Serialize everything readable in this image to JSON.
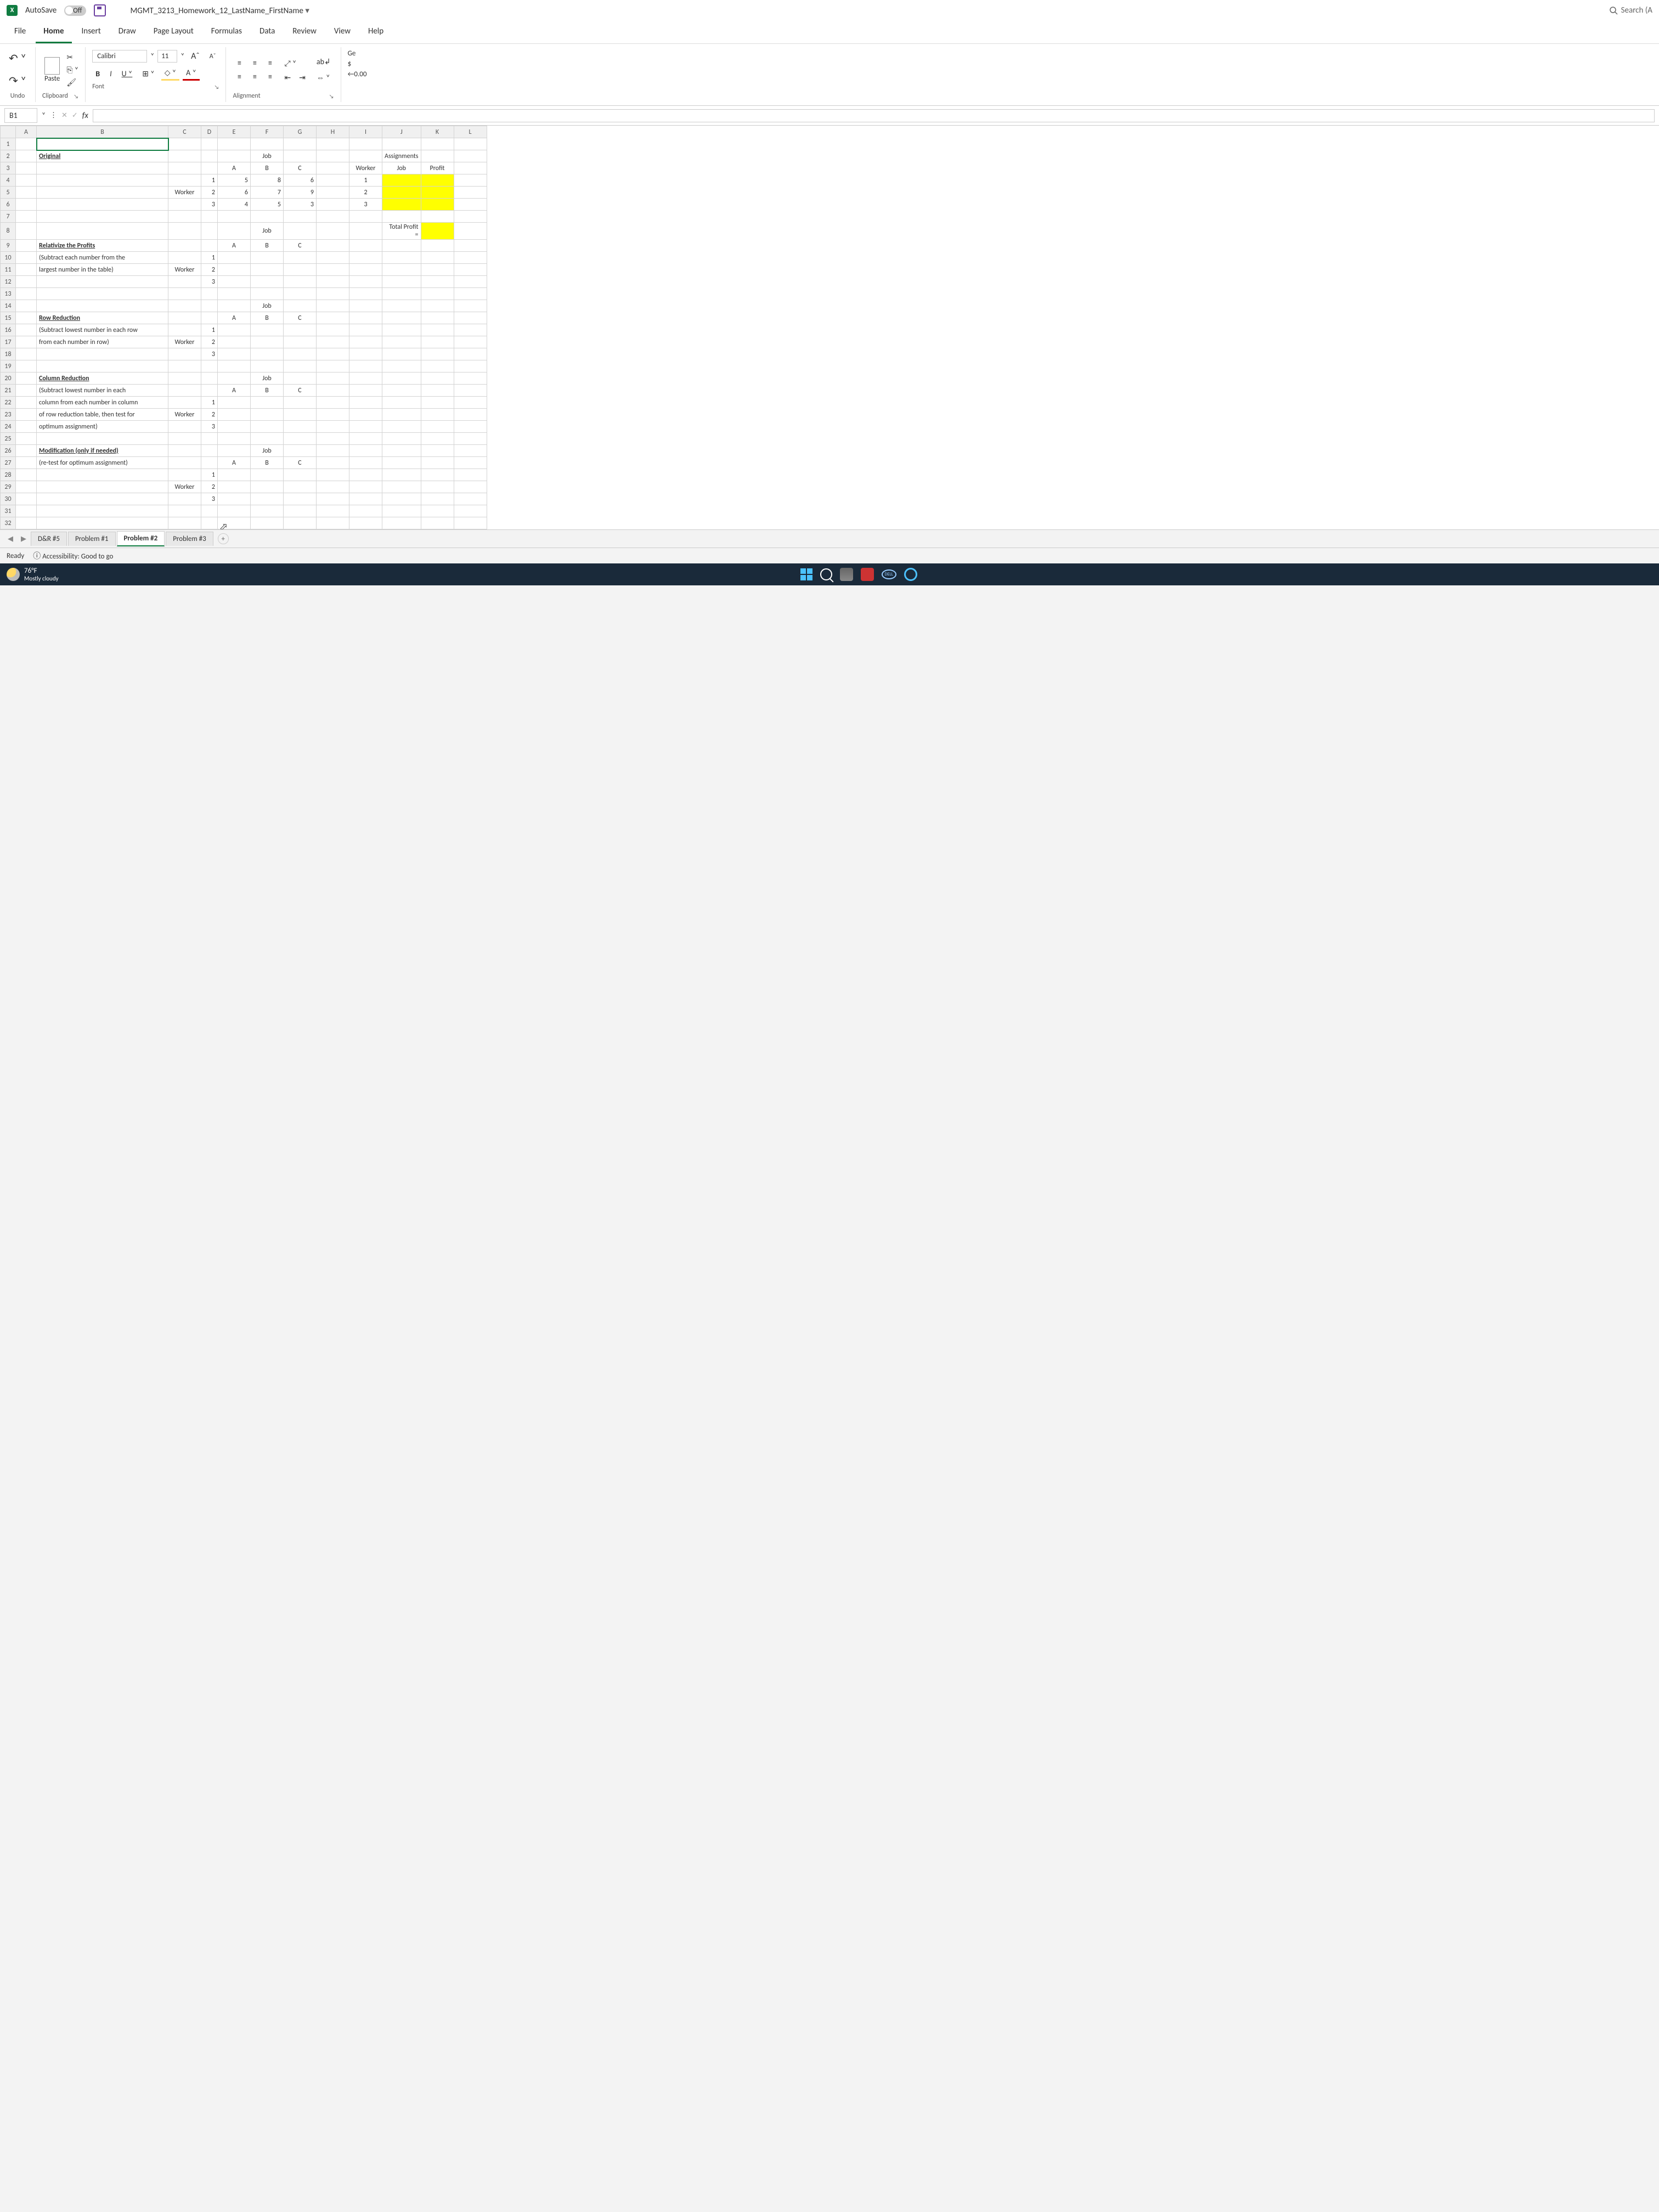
{
  "titlebar": {
    "autosave_label": "AutoSave",
    "autosave_state": "Off",
    "filename": "MGMT_3213_Homework_12_LastName_FirstName",
    "search_placeholder": "Search (A"
  },
  "ribbon": {
    "tabs": [
      "File",
      "Home",
      "Insert",
      "Draw",
      "Page Layout",
      "Formulas",
      "Data",
      "Review",
      "View",
      "Help"
    ],
    "active_tab": "Home",
    "undo_label": "Undo",
    "paste_label": "Paste",
    "clipboard_label": "Clipboard",
    "font_name": "Calibri",
    "font_size": "11",
    "font_label": "Font",
    "alignment_label": "Alignment",
    "wrap_label": "ab",
    "ge_label": "Ge",
    "currency_label": "$"
  },
  "formula": {
    "name_box": "B1",
    "fx": "fx",
    "bar_value": ""
  },
  "columns": [
    "A",
    "B",
    "C",
    "D",
    "E",
    "F",
    "G",
    "H",
    "I",
    "J",
    "K",
    "L"
  ],
  "rows_count": 32,
  "cells": {
    "r2": {
      "B": "Original",
      "F": "Job",
      "J": "Assignments"
    },
    "r3": {
      "E": "A",
      "F": "B",
      "G": "C",
      "I": "Worker",
      "J": "Job",
      "K": "Profit"
    },
    "r4": {
      "D": "1",
      "E": "5",
      "F": "8",
      "G": "6",
      "I": "1"
    },
    "r5": {
      "C": "Worker",
      "D": "2",
      "E": "6",
      "F": "7",
      "G": "9",
      "I": "2"
    },
    "r6": {
      "D": "3",
      "E": "4",
      "F": "5",
      "G": "3",
      "I": "3"
    },
    "r8": {
      "F": "Job",
      "J": "Total Profit ="
    },
    "r9": {
      "B": "Relativize the Profits",
      "E": "A",
      "F": "B",
      "G": "C"
    },
    "r10": {
      "B": "(Subtract each number from the",
      "D": "1"
    },
    "r11": {
      "B": "largest number in the table)",
      "C": "Worker",
      "D": "2"
    },
    "r12": {
      "D": "3"
    },
    "r14": {
      "F": "Job"
    },
    "r15": {
      "B": "Row Reduction",
      "E": "A",
      "F": "B",
      "G": "C"
    },
    "r16": {
      "B": "(Subtract lowest number in each row",
      "D": "1"
    },
    "r17": {
      "B": "from each number in row)",
      "C": "Worker",
      "D": "2"
    },
    "r18": {
      "D": "3"
    },
    "r20": {
      "B": "Column Reduction",
      "F": "Job"
    },
    "r21": {
      "B": "(Subtract lowest number in each",
      "E": "A",
      "F": "B",
      "G": "C"
    },
    "r22": {
      "B": "column from each number in column",
      "D": "1"
    },
    "r23": {
      "B": "of row reduction table, then test for",
      "C": "Worker",
      "D": "2"
    },
    "r24": {
      "B": "optimum assignment)",
      "D": "3"
    },
    "r26": {
      "B": "Modification (only if needed)",
      "F": "Job"
    },
    "r27": {
      "B": "(re-test for optimum assignment)",
      "E": "A",
      "F": "B",
      "G": "C"
    },
    "r28": {
      "D": "1"
    },
    "r29": {
      "C": "Worker",
      "D": "2"
    },
    "r30": {
      "D": "3"
    }
  },
  "sheet_tabs": {
    "tabs": [
      "D&R #5",
      "Problem #1",
      "Problem #2",
      "Problem #3"
    ],
    "active": "Problem #2"
  },
  "statusbar": {
    "ready": "Ready",
    "accessibility": "Accessibility: Good to go"
  },
  "taskbar": {
    "temp": "76°F",
    "weather": "Mostly cloudy",
    "dell": "DELL"
  }
}
